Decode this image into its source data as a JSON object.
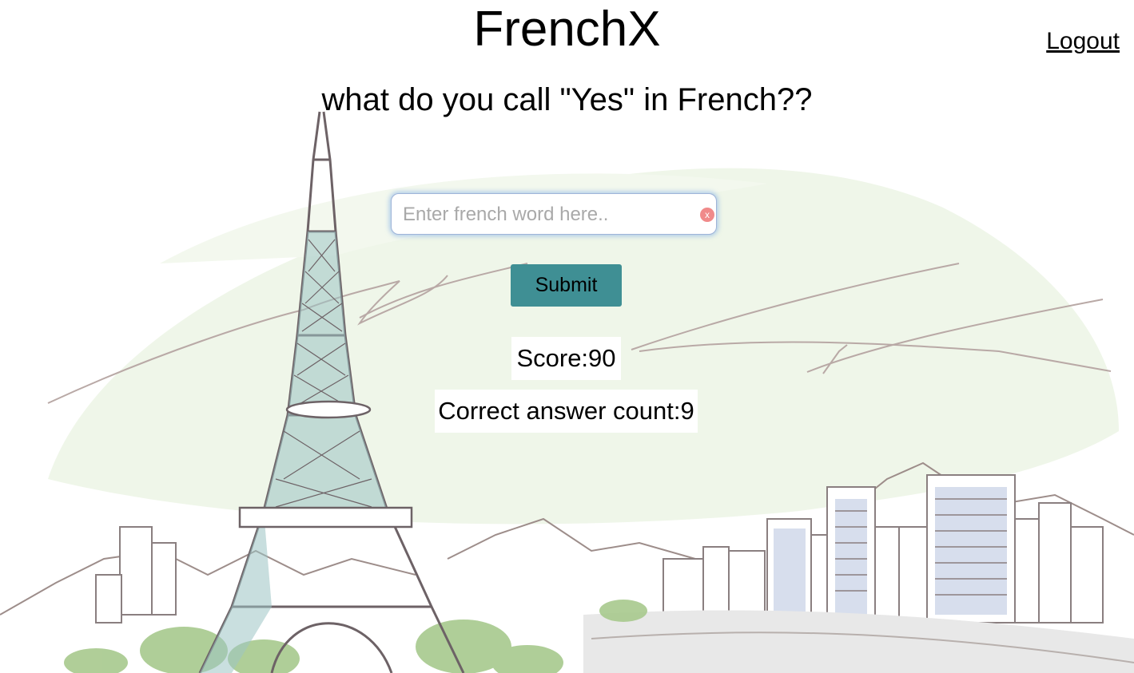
{
  "app": {
    "title": "FrenchX",
    "logout_label": "Logout"
  },
  "quiz": {
    "question": "what do you call \"Yes\" in French??",
    "answer_value": "",
    "answer_placeholder": "Enter french word here..",
    "clear_label": "x",
    "submit_label": "Submit"
  },
  "stats": {
    "score_text": "Score:90",
    "correct_count_text": "Correct answer count:9"
  },
  "background": {
    "illustration": "paris-eiffel-tower-sketch"
  },
  "colors": {
    "button_bg": "#3f8f94",
    "focus_glow": "#78aae6",
    "clear_icon": "#f08a8a"
  }
}
